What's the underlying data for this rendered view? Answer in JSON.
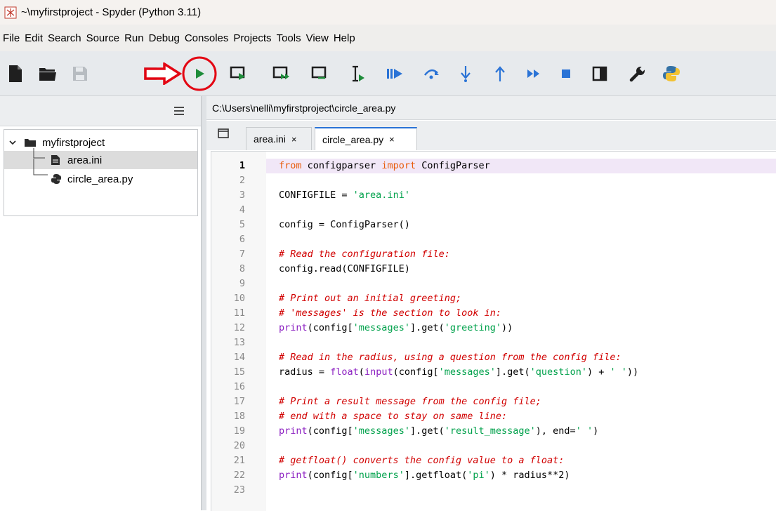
{
  "window": {
    "title": "~\\myfirstproject - Spyder (Python 3.11)"
  },
  "menu": [
    "File",
    "Edit",
    "Search",
    "Source",
    "Run",
    "Debug",
    "Consoles",
    "Projects",
    "Tools",
    "View",
    "Help"
  ],
  "toolbar": {
    "buttons": [
      "new-file",
      "open-file",
      "save-file",
      "save-all",
      "run-file",
      "run-cell",
      "run-cell-advance",
      "run-selection",
      "debug-file",
      "step-over",
      "step-into",
      "step-return",
      "continue",
      "stop-debug",
      "maximize-pane",
      "preferences",
      "python-path-manager"
    ],
    "annotation_color": "#e30613",
    "run_color": "#1e8c3a",
    "icon_color": "#2a73d6"
  },
  "path": "C:\\Users\\nelli\\myfirstproject\\circle_area.py",
  "project_tree": {
    "root": "myfirstproject",
    "files": [
      {
        "name": "area.ini",
        "selected": true
      },
      {
        "name": "circle_area.py",
        "selected": false
      }
    ]
  },
  "tabs": [
    {
      "label": "area.ini",
      "close": "×",
      "active": false
    },
    {
      "label": "circle_area.py",
      "close": "×",
      "active": true
    }
  ],
  "editor": {
    "current_line": 1,
    "lines": [
      {
        "n": "1",
        "t": [
          [
            "kw",
            "from"
          ],
          [
            "p",
            " configparser "
          ],
          [
            "kw",
            "import"
          ],
          [
            "p",
            " ConfigParser"
          ]
        ]
      },
      {
        "n": "2",
        "t": []
      },
      {
        "n": "3",
        "t": [
          [
            "p",
            "CONFIGFILE = "
          ],
          [
            "st",
            "'area.ini'"
          ]
        ]
      },
      {
        "n": "4",
        "t": []
      },
      {
        "n": "5",
        "t": [
          [
            "p",
            "config = ConfigParser()"
          ]
        ]
      },
      {
        "n": "6",
        "t": []
      },
      {
        "n": "7",
        "t": [
          [
            "cm",
            "# Read the configuration file:"
          ]
        ]
      },
      {
        "n": "8",
        "t": [
          [
            "p",
            "config.read(CONFIGFILE)"
          ]
        ]
      },
      {
        "n": "9",
        "t": []
      },
      {
        "n": "10",
        "t": [
          [
            "cm",
            "# Print out an initial greeting;"
          ]
        ]
      },
      {
        "n": "11",
        "t": [
          [
            "cm",
            "# 'messages' is the section to look in:"
          ]
        ]
      },
      {
        "n": "12",
        "t": [
          [
            "bi",
            "print"
          ],
          [
            "p",
            "(config["
          ],
          [
            "st",
            "'messages'"
          ],
          [
            "p",
            "].get("
          ],
          [
            "st",
            "'greeting'"
          ],
          [
            "p",
            "))"
          ]
        ]
      },
      {
        "n": "13",
        "t": []
      },
      {
        "n": "14",
        "t": [
          [
            "cm",
            "# Read in the radius, using a question from the config file:"
          ]
        ]
      },
      {
        "n": "15",
        "t": [
          [
            "p",
            "radius = "
          ],
          [
            "bi",
            "float"
          ],
          [
            "p",
            "("
          ],
          [
            "bi",
            "input"
          ],
          [
            "p",
            "(config["
          ],
          [
            "st",
            "'messages'"
          ],
          [
            "p",
            "].get("
          ],
          [
            "st",
            "'question'"
          ],
          [
            "p",
            ") + "
          ],
          [
            "st",
            "' '"
          ],
          [
            "p",
            "))"
          ]
        ]
      },
      {
        "n": "16",
        "t": []
      },
      {
        "n": "17",
        "t": [
          [
            "cm",
            "# Print a result message from the config file;"
          ]
        ]
      },
      {
        "n": "18",
        "t": [
          [
            "cm",
            "# end with a space to stay on same line:"
          ]
        ]
      },
      {
        "n": "19",
        "t": [
          [
            "bi",
            "print"
          ],
          [
            "p",
            "(config["
          ],
          [
            "st",
            "'messages'"
          ],
          [
            "p",
            "].get("
          ],
          [
            "st",
            "'result_message'"
          ],
          [
            "p",
            "), end="
          ],
          [
            "st",
            "' '"
          ],
          [
            "p",
            ")"
          ]
        ]
      },
      {
        "n": "20",
        "t": []
      },
      {
        "n": "21",
        "t": [
          [
            "cm",
            "# getfloat() converts the config value to a float:"
          ]
        ]
      },
      {
        "n": "22",
        "t": [
          [
            "bi",
            "print"
          ],
          [
            "p",
            "(config["
          ],
          [
            "st",
            "'numbers'"
          ],
          [
            "p",
            "].getfloat("
          ],
          [
            "st",
            "'pi'"
          ],
          [
            "p",
            ") * radius**2)"
          ]
        ]
      },
      {
        "n": "23",
        "t": []
      }
    ]
  }
}
